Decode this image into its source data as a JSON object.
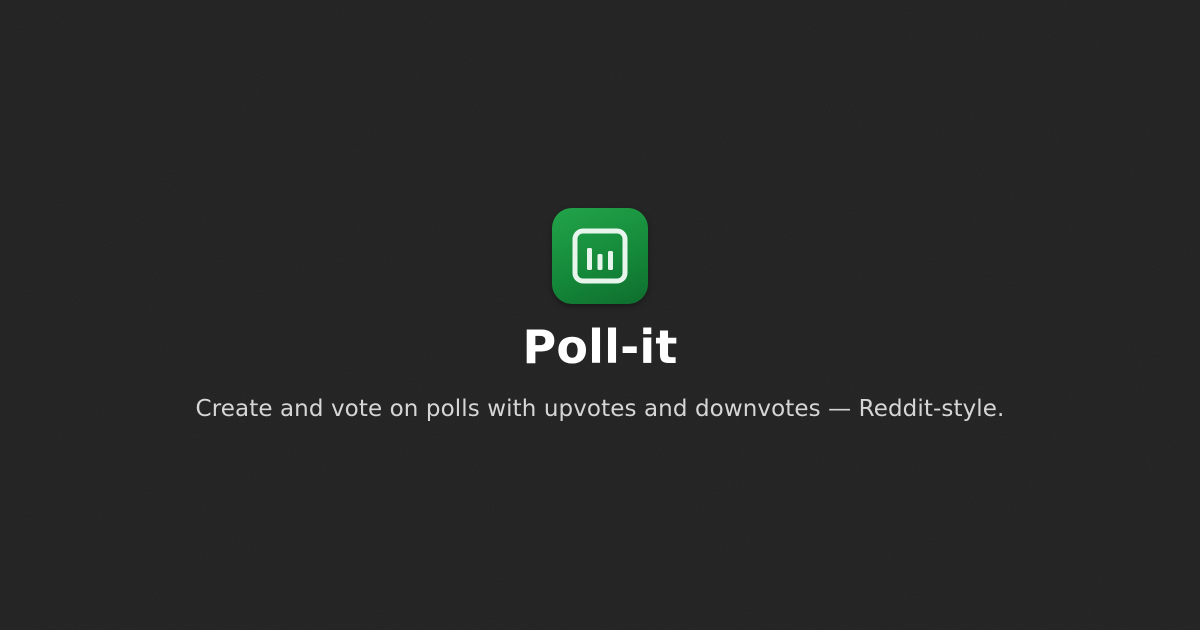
{
  "app": {
    "name": "Poll-it",
    "tagline": "Create and vote on polls with upvotes and downvotes — Reddit-style."
  },
  "logo": {
    "icon": "bar-chart-icon",
    "background_color": "#189140",
    "foreground_color": "#e8f5ec"
  },
  "theme": {
    "background": "#212121",
    "title_color": "#ffffff",
    "tagline_color": "#d6d6d6"
  }
}
